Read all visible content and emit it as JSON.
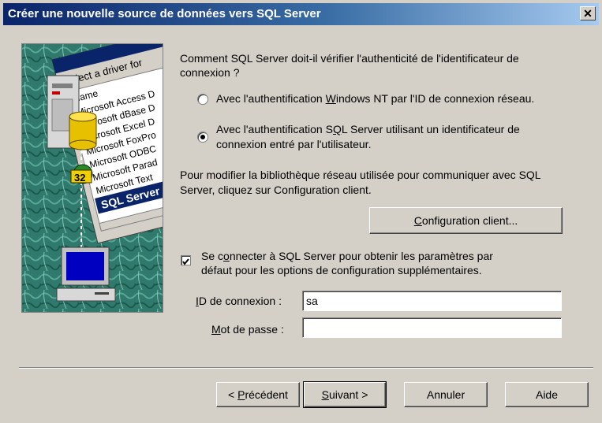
{
  "window": {
    "title": "Créer une nouvelle source de données vers SQL Server",
    "close_glyph": "✕"
  },
  "illustration": {
    "list_header": "Select a driver for",
    "column_name": "Name",
    "drivers": [
      "Microsoft Access D",
      "Microsoft dBase D",
      "Microsoft Excel D",
      "Microsoft FoxPro",
      "Microsoft ODBC",
      "Microsoft Parad",
      "Microsoft Text",
      "SQL Server"
    ],
    "badge": "32"
  },
  "auth": {
    "question": [
      "Comment SQL Server doit-il vérifier l'authenticité de l'identificateur de",
      "connexion ?"
    ],
    "options": [
      {
        "pre": "Avec l'authentification ",
        "key": "W",
        "post": "indows NT par l'ID de connexion réseau.",
        "selected": false
      },
      {
        "pre": "Avec l'authentification S",
        "key": "Q",
        "post": "L Server utilisant un identificateur de",
        "line2": "connexion entré par l'utilisateur.",
        "selected": true
      }
    ]
  },
  "network": {
    "text": [
      "Pour modifier la bibliothèque réseau utilisée pour communiquer avec SQL",
      "Server, cliquez sur Configuration client."
    ],
    "button": {
      "key": "C",
      "rest": "onfiguration client..."
    }
  },
  "connect": {
    "checked": true,
    "line1_pre": "Se c",
    "line1_key": "o",
    "line1_post": "nnecter à SQL Server pour obtenir les paramètres par",
    "line2": "défaut pour les options de configuration supplémentaires."
  },
  "login": {
    "id_key": "I",
    "id_rest": "D de connexion :",
    "id_value": "sa",
    "pw_key": "M",
    "pw_rest": "ot de passe :",
    "pw_value": ""
  },
  "buttons": {
    "prev_pre": "< ",
    "prev_key": "P",
    "prev_rest": "récédent",
    "next_key": "S",
    "next_rest": "uivant >",
    "cancel": "Annuler",
    "help": "Aide"
  }
}
